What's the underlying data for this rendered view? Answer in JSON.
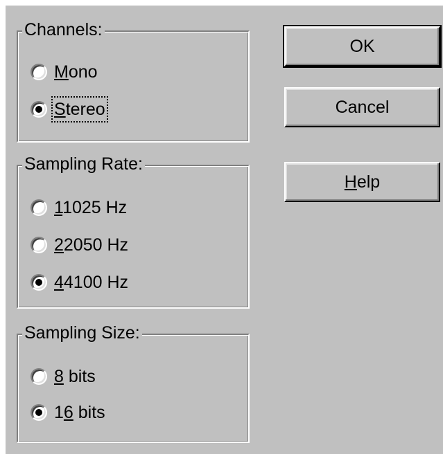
{
  "channels": {
    "legend": "Channels:",
    "mono": {
      "pre": "",
      "key": "M",
      "post": "ono",
      "checked": false
    },
    "stereo": {
      "pre": "",
      "key": "S",
      "post": "tereo",
      "checked": true
    }
  },
  "sampling_rate": {
    "legend": "Sampling Rate:",
    "r11025": {
      "pre": "",
      "key": "1",
      "post": "1025 Hz",
      "checked": false
    },
    "r22050": {
      "pre": "",
      "key": "2",
      "post": "2050 Hz",
      "checked": false
    },
    "r44100": {
      "pre": "",
      "key": "4",
      "post": "4100 Hz",
      "checked": true
    }
  },
  "sampling_size": {
    "legend": "Sampling Size:",
    "b8": {
      "pre": "",
      "key": "8",
      "post": " bits",
      "checked": false
    },
    "b16": {
      "pre": "1",
      "key": "6",
      "post": " bits",
      "checked": true
    }
  },
  "buttons": {
    "ok": {
      "pre": "OK",
      "key": "",
      "post": ""
    },
    "cancel": {
      "pre": "Cancel",
      "key": "",
      "post": ""
    },
    "help": {
      "pre": "",
      "key": "H",
      "post": "elp"
    }
  }
}
